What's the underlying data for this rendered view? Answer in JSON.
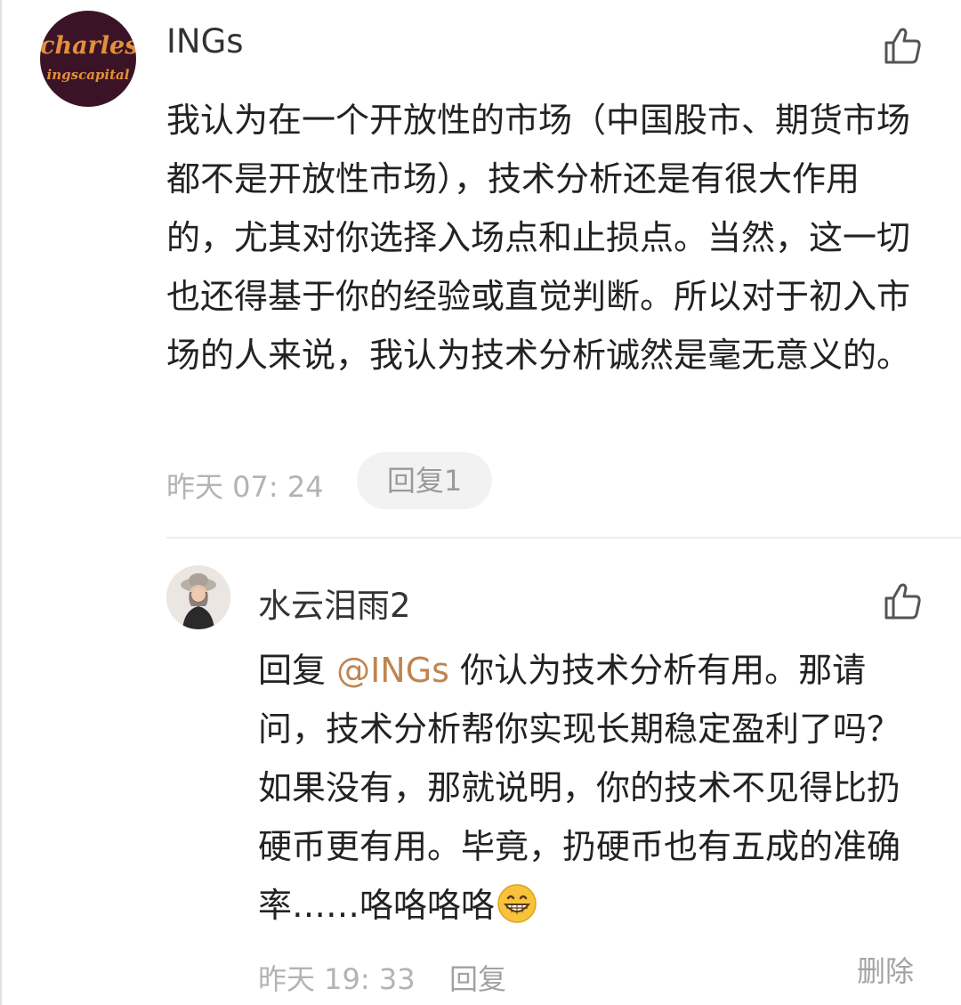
{
  "comment": {
    "avatar": {
      "line1": "charles",
      "line2": "ingscapital"
    },
    "username": "INGs",
    "like_icon": "thumbs-up-icon",
    "text": "我认为在一个开放性的市场（中国股市、期货市场都不是开放性市场），技术分析还是有很大作用的，尤其对你选择入场点和止损点。当然，这一切也还得基于你的经验或直觉判断。所以对于初入市场的人来说，我认为技术分析诚然是毫无意义的。",
    "time": "昨天 07: 24",
    "reply_button": "回复1"
  },
  "reply": {
    "avatar": "girl-with-hat-avatar",
    "username": "水云泪雨2",
    "like_icon": "thumbs-up-icon",
    "prefix": "回复 ",
    "mention": "@INGs",
    "text": " 你认为技术分析有用。那请问，技术分析帮你实现长期稳定盈利了吗？如果没有，那就说明，你的技术不见得比扔硬币更有用。毕竟，扔硬币也有五成的准确率……咯咯咯咯",
    "emoji": "grinning-face-emoji",
    "time": "昨天 19: 33",
    "reply_label": "回复",
    "delete_label": "删除"
  },
  "colors": {
    "mention": "#c08450",
    "meta": "#b3b3b3",
    "avatar_bg": "#3a1426",
    "avatar_text": "#e38f3c"
  }
}
